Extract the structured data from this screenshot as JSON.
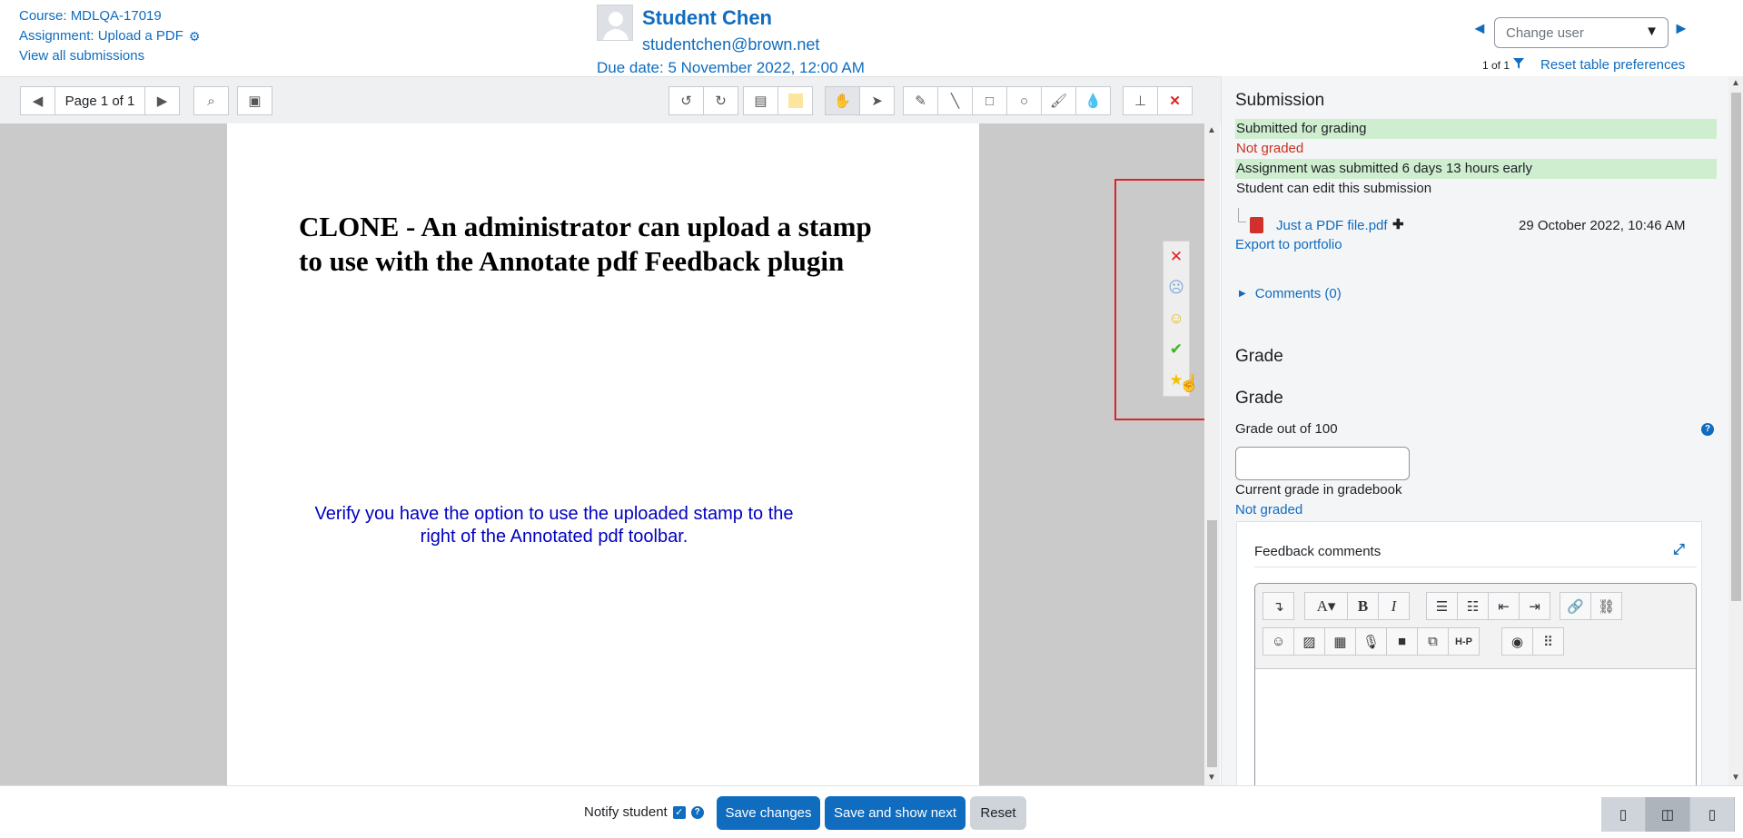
{
  "header": {
    "course": "Course: MDLQA-17019",
    "assignment": "Assignment: Upload a PDF",
    "view_all": "View all submissions",
    "student_name": "Student Chen",
    "student_email": "studentchen@brown.net",
    "due_date": "Due date: 5 November 2022, 12:00 AM",
    "change_user_placeholder": "Change user",
    "count": "1 of 1",
    "reset_table": "Reset table preferences"
  },
  "toolbar": {
    "page_label": "Page 1 of 1"
  },
  "pdf": {
    "title": "CLONE - An administrator can upload a stamp to use with the Annotate pdf Feedback plugin",
    "note": "Verify you have the option to use the uploaded stamp to the right of the Annotated pdf toolbar."
  },
  "panel": {
    "submission_heading": "Submission",
    "status_submitted": "Submitted for grading",
    "status_not_graded": "Not graded",
    "status_early": "Assignment was submitted 6 days 13 hours early",
    "status_edit": "Student can edit this submission",
    "file_name": "Just a PDF file.pdf",
    "file_date": "29 October 2022, 10:46 AM",
    "export": "Export to portfolio",
    "comments": "Comments (0)",
    "grade_section": "Grade",
    "grade_heading": "Grade",
    "grade_out_of": "Grade out of 100",
    "current_grade_label": "Current grade in gradebook",
    "current_grade_value": "Not graded",
    "feedback_comments": "Feedback comments"
  },
  "footer": {
    "notify_label": "Notify student",
    "save_changes": "Save changes",
    "save_next": "Save and show next",
    "reset": "Reset"
  },
  "colors": {
    "accent": "#0f6cbf",
    "success_bg": "#cfeecf",
    "danger": "#ca3120",
    "highlight": "#d9262a"
  }
}
